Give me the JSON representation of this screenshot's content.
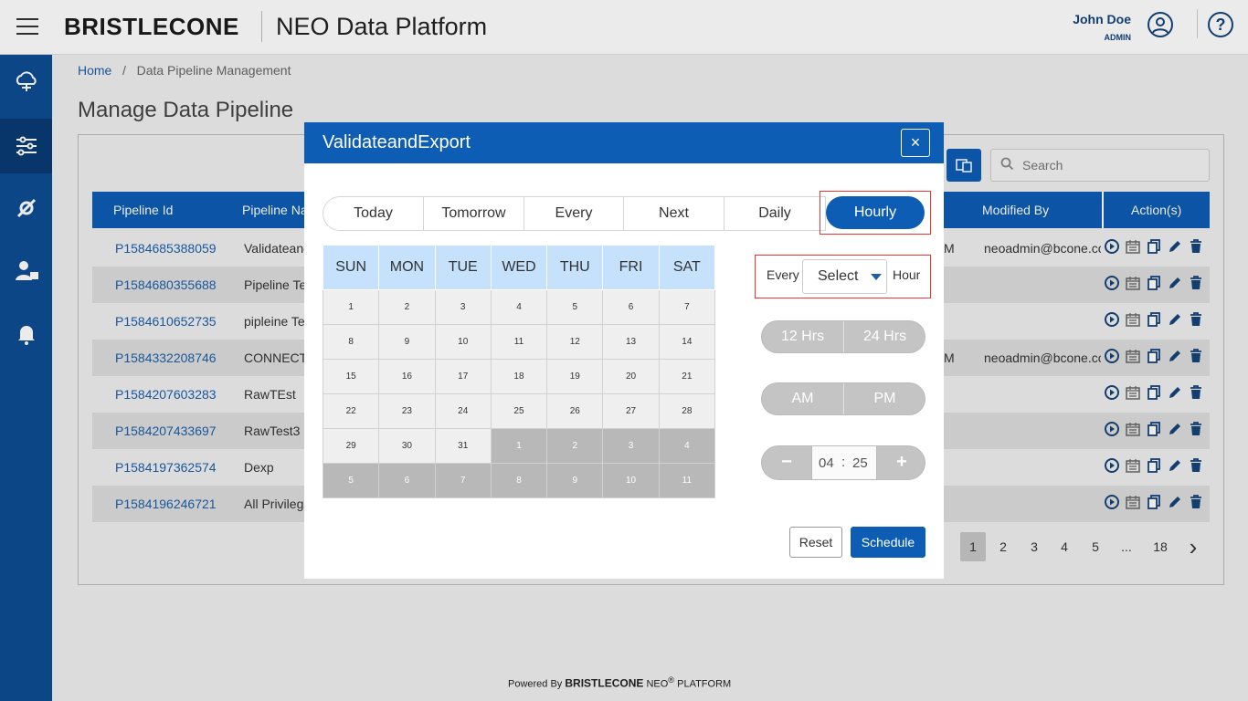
{
  "header": {
    "logo": "BRISTLECONE",
    "app_title": "NEO Data Platform",
    "user_name": "John Doe",
    "user_role": "ADMIN",
    "help": "?"
  },
  "breadcrumb": {
    "home": "Home",
    "sep": "/",
    "current": "Data Pipeline Management"
  },
  "page_title": "Manage Data Pipeline",
  "search": {
    "placeholder": "Search"
  },
  "table": {
    "headers": {
      "id": "Pipeline Id",
      "name": "Pipeline Na",
      "modified_by": "Modified By",
      "actions": "Action(s)"
    },
    "rows": [
      {
        "id": "P1584685388059",
        "name": "Validateand",
        "pm": "M",
        "modified_by": "neoadmin@bcone.co"
      },
      {
        "id": "P1584680355688",
        "name": "Pipeline Te",
        "pm": "",
        "modified_by": ""
      },
      {
        "id": "P1584610652735",
        "name": "pipleine Te",
        "pm": "",
        "modified_by": ""
      },
      {
        "id": "P1584332208746",
        "name": "CONNECTI",
        "pm": "M",
        "modified_by": "neoadmin@bcone.co"
      },
      {
        "id": "P1584207603283",
        "name": "RawTEst",
        "pm": "",
        "modified_by": ""
      },
      {
        "id": "P1584207433697",
        "name": "RawTest3",
        "pm": "",
        "modified_by": ""
      },
      {
        "id": "P1584197362574",
        "name": "Dexp",
        "pm": "",
        "modified_by": ""
      },
      {
        "id": "P1584196246721",
        "name": "All Privileg",
        "pm": "",
        "modified_by": ""
      }
    ]
  },
  "pagination": {
    "pages": [
      "1",
      "2",
      "3",
      "4",
      "5",
      "...",
      "18"
    ],
    "current": "1",
    "next": "›"
  },
  "footer": {
    "powered_by": "Powered By",
    "brand": "BRISTLECONE",
    "neo": "NEO",
    "reg": "®",
    "platform": "PLATFORM"
  },
  "modal": {
    "title": "ValidateandExport",
    "close": "×",
    "tabs": [
      "Today",
      "Tomorrow",
      "Every",
      "Next",
      "Daily",
      "Hourly"
    ],
    "selected_tab": "Hourly",
    "weekdays": [
      "SUN",
      "MON",
      "TUE",
      "WED",
      "THU",
      "FRI",
      "SAT"
    ],
    "calendar_weeks": [
      [
        "1",
        "2",
        "3",
        "4",
        "5",
        "6",
        "7"
      ],
      [
        "8",
        "9",
        "10",
        "11",
        "12",
        "13",
        "14"
      ],
      [
        "15",
        "16",
        "17",
        "18",
        "19",
        "20",
        "21"
      ],
      [
        "22",
        "23",
        "24",
        "25",
        "26",
        "27",
        "28"
      ],
      [
        "29",
        "30",
        "31",
        "1",
        "2",
        "3",
        "4"
      ],
      [
        "5",
        "6",
        "7",
        "8",
        "9",
        "10",
        "11"
      ]
    ],
    "every_label": "Every",
    "select_value": "Select",
    "hour_label": "Hour",
    "format": {
      "left": "12 Hrs",
      "right": "24 Hrs"
    },
    "ampm": {
      "left": "AM",
      "right": "PM"
    },
    "time": {
      "minus": "−",
      "hours": "04",
      "colon": ":",
      "minutes": "25",
      "plus": "+"
    },
    "reset": "Reset",
    "schedule": "Schedule"
  },
  "colors": {
    "primary": "#0e5db5",
    "sidebar": "#0e4d93",
    "highlight_border": "#ee3333",
    "calendar_header": "#c5e1fb"
  }
}
